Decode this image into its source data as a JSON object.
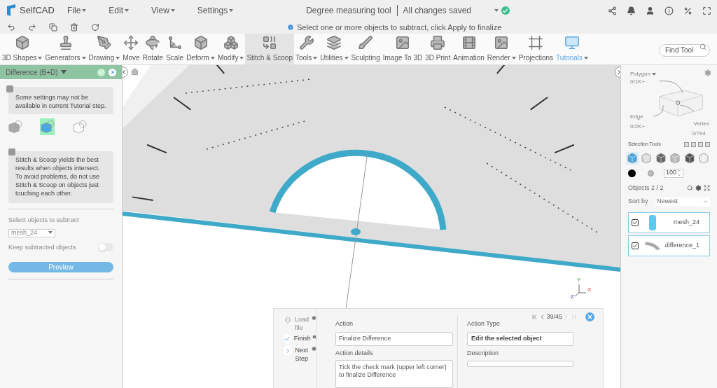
{
  "app": {
    "name": "SelfCAD"
  },
  "menu": [
    {
      "label": "File"
    },
    {
      "label": "Edit"
    },
    {
      "label": "View"
    },
    {
      "label": "Settings"
    }
  ],
  "document": {
    "title": "Degree measuring tool",
    "status": "All changes saved",
    "saved": true
  },
  "hint": "Select one or more objects to subtract, click Apply to finalize",
  "toolbar": [
    {
      "label": "3D Shapes",
      "dropdown": true,
      "selected": false
    },
    {
      "label": "Generators",
      "dropdown": true,
      "selected": false
    },
    {
      "label": "Drawing",
      "dropdown": true,
      "selected": false
    },
    {
      "label": "Move",
      "dropdown": false,
      "selected": false
    },
    {
      "label": "Rotate",
      "dropdown": false,
      "selected": false
    },
    {
      "label": "Scale",
      "dropdown": false,
      "selected": false
    },
    {
      "label": "Deform",
      "dropdown": true,
      "selected": false
    },
    {
      "label": "Modify",
      "dropdown": true,
      "selected": false
    },
    {
      "label": "Stitch & Scoop",
      "dropdown": false,
      "selected": true
    },
    {
      "label": "Tools",
      "dropdown": true,
      "selected": false
    },
    {
      "label": "Utilities",
      "dropdown": true,
      "selected": false
    },
    {
      "label": "Sculpting",
      "dropdown": false,
      "selected": false
    },
    {
      "label": "Image To 3D",
      "dropdown": false,
      "selected": false
    },
    {
      "label": "3D Print",
      "dropdown": false,
      "selected": false
    },
    {
      "label": "Animation",
      "dropdown": false,
      "selected": false
    },
    {
      "label": "Render",
      "dropdown": true,
      "selected": false
    },
    {
      "label": "Projections",
      "dropdown": false,
      "selected": false
    },
    {
      "label": "Tutorials",
      "dropdown": true,
      "selected": false
    }
  ],
  "find_tool": {
    "placeholder": "Find Tool"
  },
  "left_panel": {
    "title": "Difference (B+D)",
    "notice": "Some settings may not be available in current Tutorial step.",
    "modes": [
      {
        "selected": false
      },
      {
        "selected": true
      },
      {
        "selected": false
      }
    ],
    "info": "Stitch & Scoop yields the best results when objects intersect. To avoid problems, do not use Stitch & Scoop on objects just touching each other.",
    "select_label": "Select objects to subtract",
    "select_value": "mesh_24",
    "keep": {
      "label": "Keep subtracted objects",
      "on": false
    },
    "preview": "Preview"
  },
  "viewport": {
    "axes": [
      "Y",
      "X",
      "Z"
    ]
  },
  "right_panel": {
    "polygon": "Polygon",
    "polygon_count": "0/1K+",
    "edge": "Edge",
    "edge_count": "0/2K+",
    "vertex": "Vertex",
    "vertex_count": "0/794",
    "selection_title": "Selection Tools",
    "selection_tools": [
      {
        "selected": true
      },
      {
        "selected": false
      },
      {
        "selected": false
      },
      {
        "selected": false
      },
      {
        "selected": false
      },
      {
        "selected": false
      }
    ],
    "size": "100",
    "objects_title": "Objects 2 / 2",
    "sort_label": "Sort by",
    "sort_value": "Newest",
    "objects": [
      {
        "name": "mesh_24",
        "checked": true,
        "selected": true
      },
      {
        "name": "difference_1",
        "checked": true,
        "selected": true
      }
    ]
  },
  "tutorial": {
    "steps": [
      {
        "label": "Load file",
        "kind": "load",
        "disabled": true
      },
      {
        "label": "Finish",
        "kind": "done",
        "disabled": false
      },
      {
        "label": "Next Step",
        "kind": "next",
        "disabled": false
      }
    ],
    "counter": "39/45",
    "action_label": "Action",
    "action": "Finalize Difference",
    "details_label": "Action details",
    "details": "Tick the check mark (upper left corner) to finalize Difference",
    "type_label": "Action Type",
    "type": "Edit the selected object",
    "description_label": "Description"
  }
}
